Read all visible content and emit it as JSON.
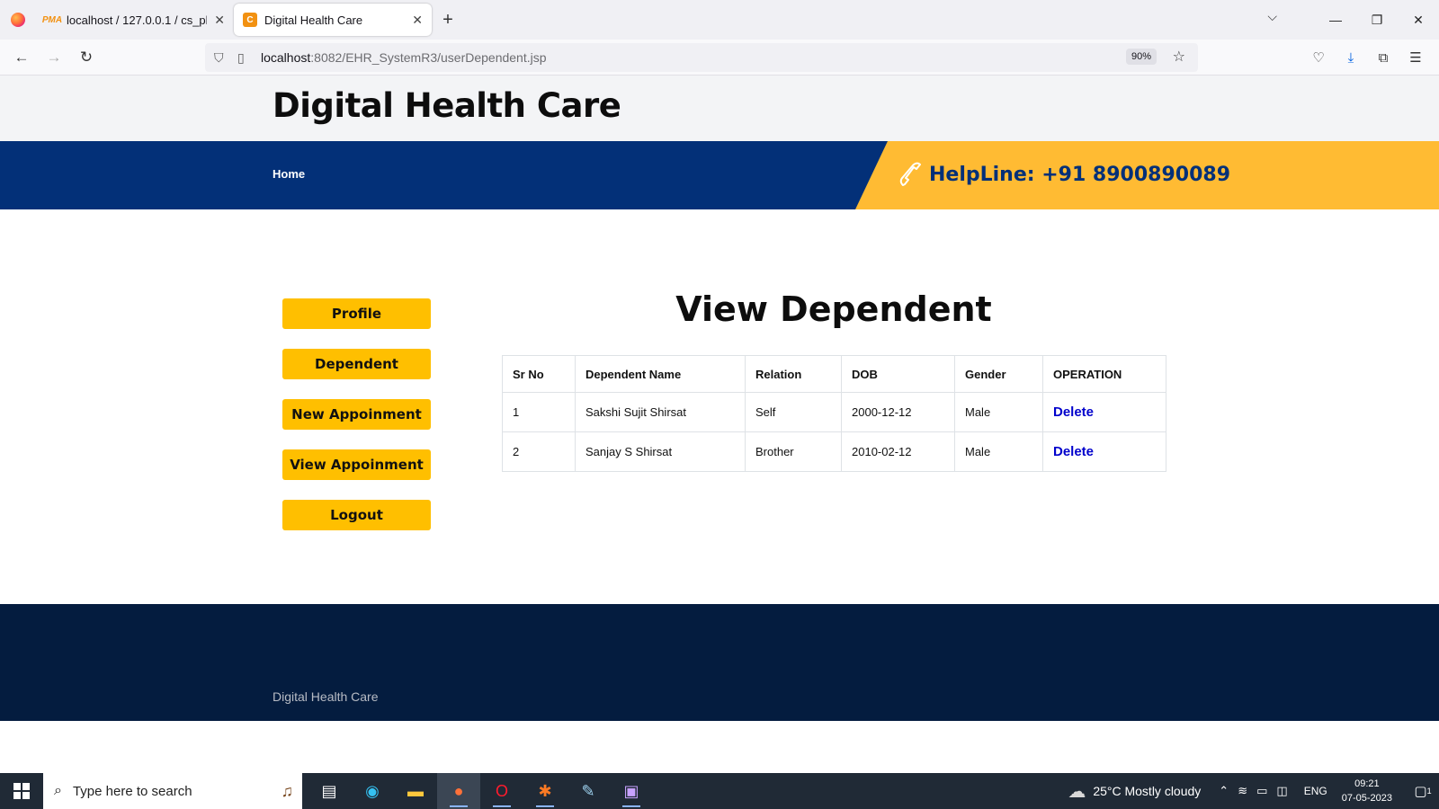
{
  "browser": {
    "tabs": [
      {
        "title": "localhost / 127.0.0.1 / cs_photo",
        "favicon": "PMA",
        "active": false
      },
      {
        "title": "Digital Health Care",
        "favicon": "C",
        "active": true
      }
    ],
    "url_host": "localhost",
    "url_path": ":8082/EHR_SystemR3/userDependent.jsp",
    "zoom": "90%"
  },
  "site": {
    "title": "Digital Health Care",
    "nav": {
      "home": "Home"
    },
    "helpline": "HelpLine: +91 8900890089",
    "colors": {
      "blue": "#033078",
      "yellow": "#ffbb33",
      "button": "#ffbf00",
      "footer": "#041c3f"
    }
  },
  "sidebar": {
    "items": [
      {
        "label": "Profile"
      },
      {
        "label": "Dependent"
      },
      {
        "label": "New Appoinment"
      },
      {
        "label": "View Appoinment"
      },
      {
        "label": "Logout"
      }
    ]
  },
  "main": {
    "heading": "View Dependent",
    "table": {
      "headers": [
        "Sr No",
        "Dependent Name",
        "Relation",
        "DOB",
        "Gender",
        "OPERATION"
      ],
      "rows": [
        {
          "sr": "1",
          "name": "Sakshi Sujit Shirsat",
          "relation": "Self",
          "dob": "2000-12-12",
          "gender": "Male",
          "op": "Delete"
        },
        {
          "sr": "2",
          "name": "Sanjay S Shirsat",
          "relation": "Brother",
          "dob": "2010-02-12",
          "gender": "Male",
          "op": "Delete"
        }
      ]
    }
  },
  "footer": {
    "text": "Digital Health Care"
  },
  "taskbar": {
    "search_placeholder": "Type here to search",
    "weather": "25°C  Mostly cloudy",
    "lang": "ENG",
    "time": "09:21",
    "date": "07-05-2023",
    "notifications": "1"
  }
}
